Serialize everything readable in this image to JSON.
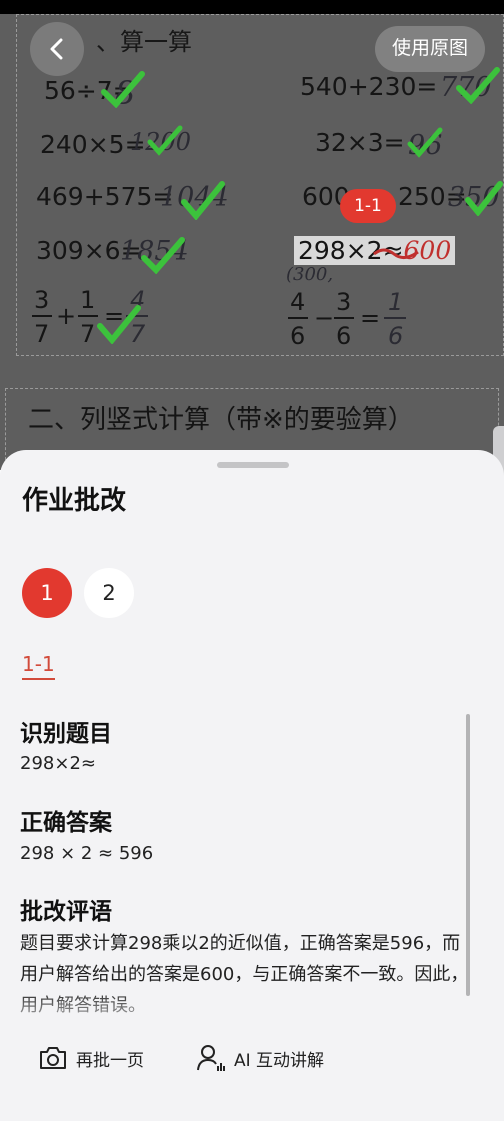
{
  "photo": {
    "section1_title": "、算一算",
    "use_original_label": "使用原图",
    "questions": {
      "q1": "56÷7=",
      "q1_ans": "8",
      "q2": "540+230=",
      "q2_ans": "770",
      "q3": "240×5=",
      "q3_ans": "1200",
      "q4": "32×3=",
      "q4_ans": "96",
      "q5": "469+575=",
      "q5_ans": "1044",
      "q6a": "600",
      "q6b": "250=",
      "q6_ans": "350",
      "q7": "309×6=",
      "q7_ans": "1854",
      "q8": "298×2≈",
      "q8_ans": "600",
      "q8_note": "(300,",
      "q9_n1": "3",
      "q9_d1": "7",
      "q9_op": "+",
      "q9_n2": "1",
      "q9_d2": "7",
      "q9_eq": "=",
      "q9_ans_n": "4",
      "q9_ans_d": "7",
      "q10_n1": "4",
      "q10_d1": "6",
      "q10_op": "−",
      "q10_n2": "3",
      "q10_d2": "6",
      "q10_eq": "=",
      "q10_ans_n": "1",
      "q10_ans_d": "6"
    },
    "marker_label": "1-1",
    "section2_title": "二、列竖式计算（带※的要验算）"
  },
  "sheet": {
    "title": "作业批改",
    "pages": [
      "1",
      "2"
    ],
    "sub_tab": "1-1",
    "recognize_heading": "识别题目",
    "recognize_value": "298×2≈",
    "answer_heading": "正确答案",
    "answer_value": "298 × 2 ≈ 596",
    "comment_heading": "批改评语",
    "comment_text": "题目要求计算298乘以2的近似值，正确答案是596，而用户解答给出的答案是600，与正确答案不一致。因此，用户解答错误。",
    "actions": {
      "retry_label": "再批一页",
      "ai_label": "AI 互动讲解"
    }
  },
  "colors": {
    "accent": "#e2392f",
    "check": "#3cc23c"
  },
  "icons": [
    "back-arrow-icon",
    "camera-icon",
    "ai-person-wave-icon"
  ]
}
